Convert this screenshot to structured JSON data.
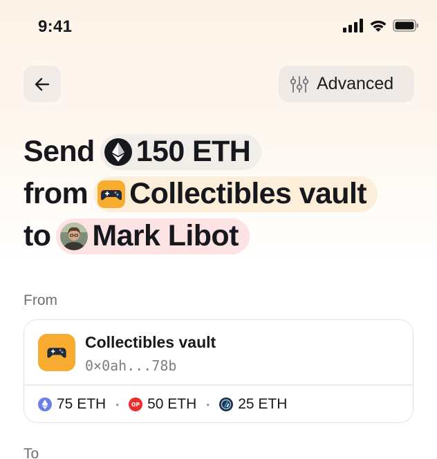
{
  "status_bar": {
    "time": "9:41"
  },
  "header": {
    "advanced_label": "Advanced"
  },
  "headline": {
    "send_word": "Send",
    "amount": "150 ETH",
    "from_word": "from",
    "vault": "Collectibles vault",
    "to_word": "to",
    "recipient": "Mark Libot"
  },
  "from_section": {
    "label": "From",
    "account_name": "Collectibles vault",
    "account_address": "0×0ah...78b",
    "balances": [
      {
        "network": "ethereum",
        "amount": "75 ETH"
      },
      {
        "network": "optimism",
        "amount": "50 ETH"
      },
      {
        "network": "arbitrum",
        "amount": "25 ETH"
      }
    ]
  },
  "to_section": {
    "label": "To"
  },
  "colors": {
    "vault_orange": "#f7ac30",
    "chip_vault": "#fdeed9",
    "chip_recipient": "#fde3e3",
    "optimism_red": "#ea2e2e",
    "ethereum_blue": "#6b7ee8",
    "arbitrum_navy": "#213147"
  }
}
